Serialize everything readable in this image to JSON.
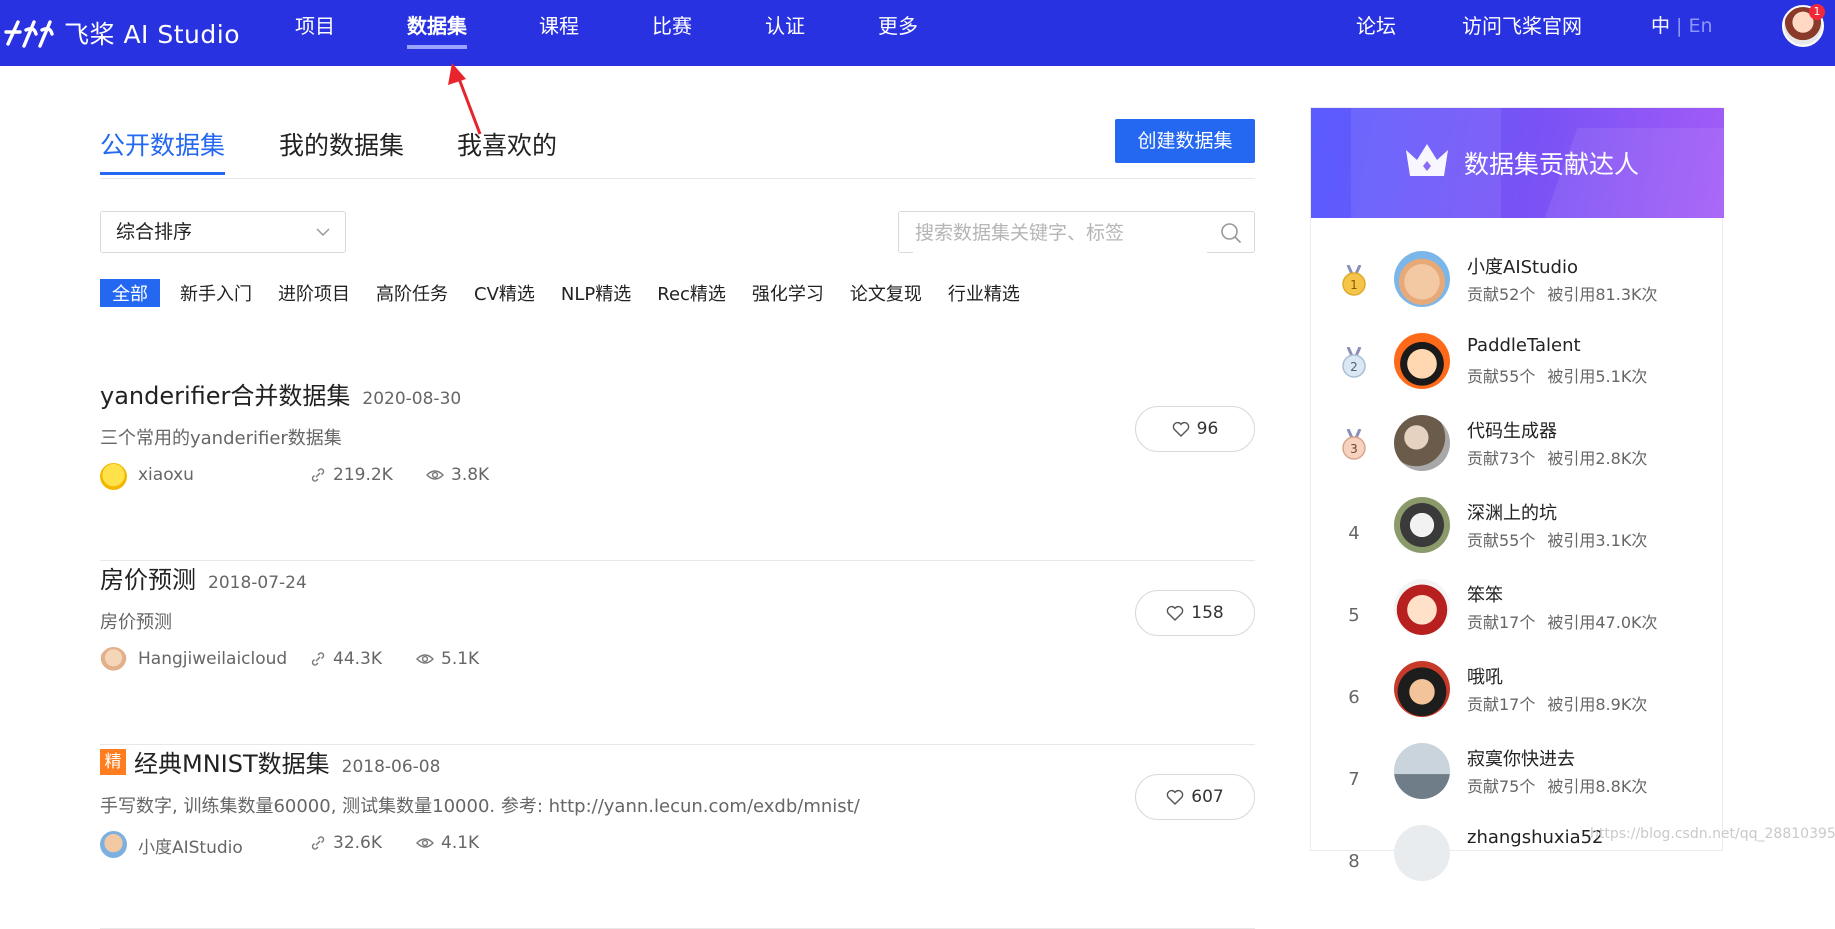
{
  "brand": {
    "logo_text": "飞桨 AI Studio"
  },
  "nav": {
    "items": [
      {
        "label": "项目",
        "active": false
      },
      {
        "label": "数据集",
        "active": true
      },
      {
        "label": "课程",
        "active": false
      },
      {
        "label": "比赛",
        "active": false
      },
      {
        "label": "认证",
        "active": false
      },
      {
        "label": "更多",
        "active": false
      }
    ],
    "forum": "论坛",
    "official_site": "访问飞桨官网",
    "lang_zh": "中",
    "lang_sep": " | ",
    "lang_en": "En",
    "notification_count": "1"
  },
  "tabs": [
    {
      "label": "公开数据集",
      "active": true
    },
    {
      "label": "我的数据集",
      "active": false
    },
    {
      "label": "我喜欢的",
      "active": false
    }
  ],
  "create_button": "创建数据集",
  "sort": {
    "value": "综合排序"
  },
  "search": {
    "placeholder": "搜索数据集关键字、标签"
  },
  "filters": [
    "全部",
    "新手入门",
    "进阶项目",
    "高阶任务",
    "CV精选",
    "NLP精选",
    "Rec精选",
    "强化学习",
    "论文复现",
    "行业精选"
  ],
  "datasets": [
    {
      "title": "yanderifier合并数据集",
      "date": "2020-08-30",
      "featured": false,
      "desc": "三个常用的yanderifier数据集",
      "author": "xiaoxu",
      "refs": "219.2K",
      "views": "3.8K",
      "likes": "96"
    },
    {
      "title": "房价预测",
      "date": "2018-07-24",
      "featured": false,
      "desc": "房价预测",
      "author": "Hangjiweilaicloud",
      "refs": "44.3K",
      "views": "5.1K",
      "likes": "158"
    },
    {
      "title": "经典MNIST数据集",
      "date": "2018-06-08",
      "featured": true,
      "featured_label": "精",
      "desc": "手写数字, 训练集数量60000, 测试集数量10000. 参考: http://yann.lecun.com/exdb/mnist/",
      "author": "小度AIStudio",
      "refs": "32.6K",
      "views": "4.1K",
      "likes": "607"
    }
  ],
  "sidebar": {
    "title": "数据集贡献达人",
    "contributors": [
      {
        "rank": "1",
        "name": "小度AIStudio",
        "contrib": "贡献52个",
        "cited": "被引用81.3K次"
      },
      {
        "rank": "2",
        "name": "PaddleTalent",
        "contrib": "贡献55个",
        "cited": "被引用5.1K次"
      },
      {
        "rank": "3",
        "name": "代码生成器",
        "contrib": "贡献73个",
        "cited": "被引用2.8K次"
      },
      {
        "rank": "4",
        "name": "深渊上的坑",
        "contrib": "贡献55个",
        "cited": "被引用3.1K次"
      },
      {
        "rank": "5",
        "name": "笨笨",
        "contrib": "贡献17个",
        "cited": "被引用47.0K次"
      },
      {
        "rank": "6",
        "name": "哦吼",
        "contrib": "贡献17个",
        "cited": "被引用8.9K次"
      },
      {
        "rank": "7",
        "name": "寂寞你快进去",
        "contrib": "贡献75个",
        "cited": "被引用8.8K次"
      },
      {
        "rank": "8",
        "name": "zhangshuxia52",
        "contrib": "",
        "cited": ""
      }
    ]
  },
  "watermark": "https://blog.csdn.net/qq_28810395",
  "colors": {
    "nav_bg": "#2932e1",
    "accent": "#2468f2",
    "featured_tag": "#ff7d1f",
    "annotation_arrow": "#e8242c"
  }
}
